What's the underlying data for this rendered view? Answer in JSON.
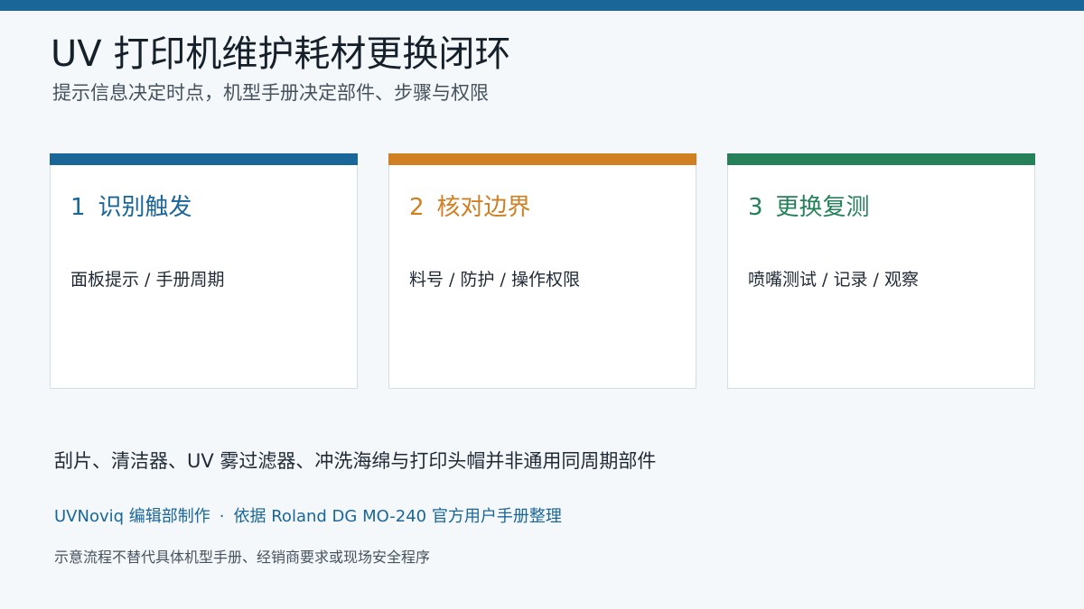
{
  "header": {
    "title": "UV 打印机维护耗材更换闭环",
    "subtitle": "提示信息决定时点，机型手册决定部件、步骤与权限"
  },
  "colors": {
    "top_bar": "#1a6699",
    "background": "#f4f8fa"
  },
  "steps": [
    {
      "number": "1",
      "title": "识别触发",
      "body": "面板提示 / 手册周期",
      "accent": "#1a6699"
    },
    {
      "number": "2",
      "title": "核对边界",
      "body": "料号 / 防护 / 操作权限",
      "accent": "#d07f22"
    },
    {
      "number": "3",
      "title": "更换复测",
      "body": "喷嘴测试 / 记录 / 观察",
      "accent": "#26805a"
    }
  ],
  "footer": {
    "note": "刮片、清洁器、UV 雾过滤器、冲洗海绵与打印头帽并非通用同周期部件",
    "credit_left": "UVNoviq 编辑部制作",
    "credit_separator": "·",
    "credit_right": "依据 Roland DG MO-240 官方用户手册整理",
    "disclaimer": "示意流程不替代具体机型手册、经销商要求或现场安全程序"
  }
}
